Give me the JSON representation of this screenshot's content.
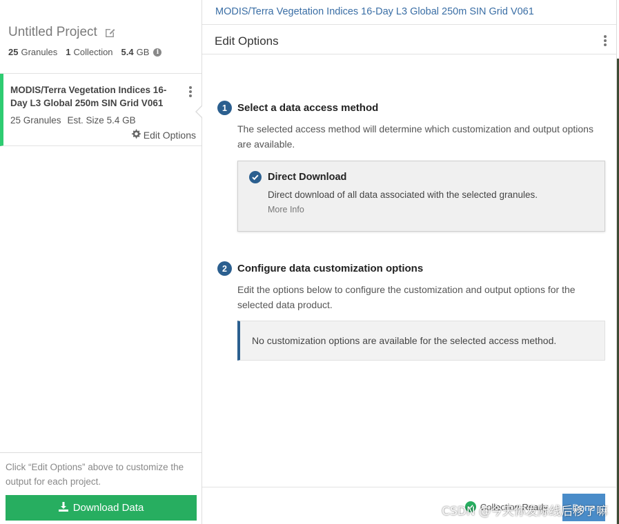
{
  "sidebar": {
    "project_title": "Untitled Project",
    "stats": {
      "granules_count": "25",
      "granules_label": "Granules",
      "collections_count": "1",
      "collections_label": "Collection",
      "size_value": "5.4",
      "size_unit": "GB"
    },
    "collection": {
      "title": "MODIS/Terra Vegetation Indices 16-Day L3 Global 250m SIN Grid V061",
      "granules": "25 Granules",
      "est_size": "Est. Size 5.4 GB",
      "edit_options_label": "Edit Options",
      "accent_color": "#2ecc71"
    },
    "footer_hint": "Click “Edit Options” above to customize the output for each project.",
    "download_label": "Download Data"
  },
  "panel": {
    "collection_title": "MODIS/Terra Vegetation Indices 16-Day L3 Global 250m SIN Grid V061",
    "header_title": "Edit Options",
    "steps": [
      {
        "number": "1",
        "title": "Select a data access method",
        "description": "The selected access method will determine which customization and output options are available."
      },
      {
        "number": "2",
        "title": "Configure data customization options",
        "description": "Edit the options below to configure the customization and output options for the selected data product."
      }
    ],
    "access_method": {
      "name": "Direct Download",
      "description": "Direct download of all data associated with the selected granules.",
      "more_info": "More Info"
    },
    "no_customization": "No customization options are available for the selected access method.",
    "footer": {
      "collection_ready": "Collection Ready",
      "done_label": "Done"
    }
  },
  "watermark": "CSDN @今天你发际线后移了嘛",
  "colors": {
    "primary_blue": "#2b5f8f",
    "link_blue": "#3a6ea5",
    "green": "#27ae60",
    "done_blue": "#4a8cc9"
  },
  "icons": [
    "edit-icon",
    "info-icon",
    "kebab-icon",
    "gear-icon",
    "download-icon",
    "check-circle-icon"
  ]
}
